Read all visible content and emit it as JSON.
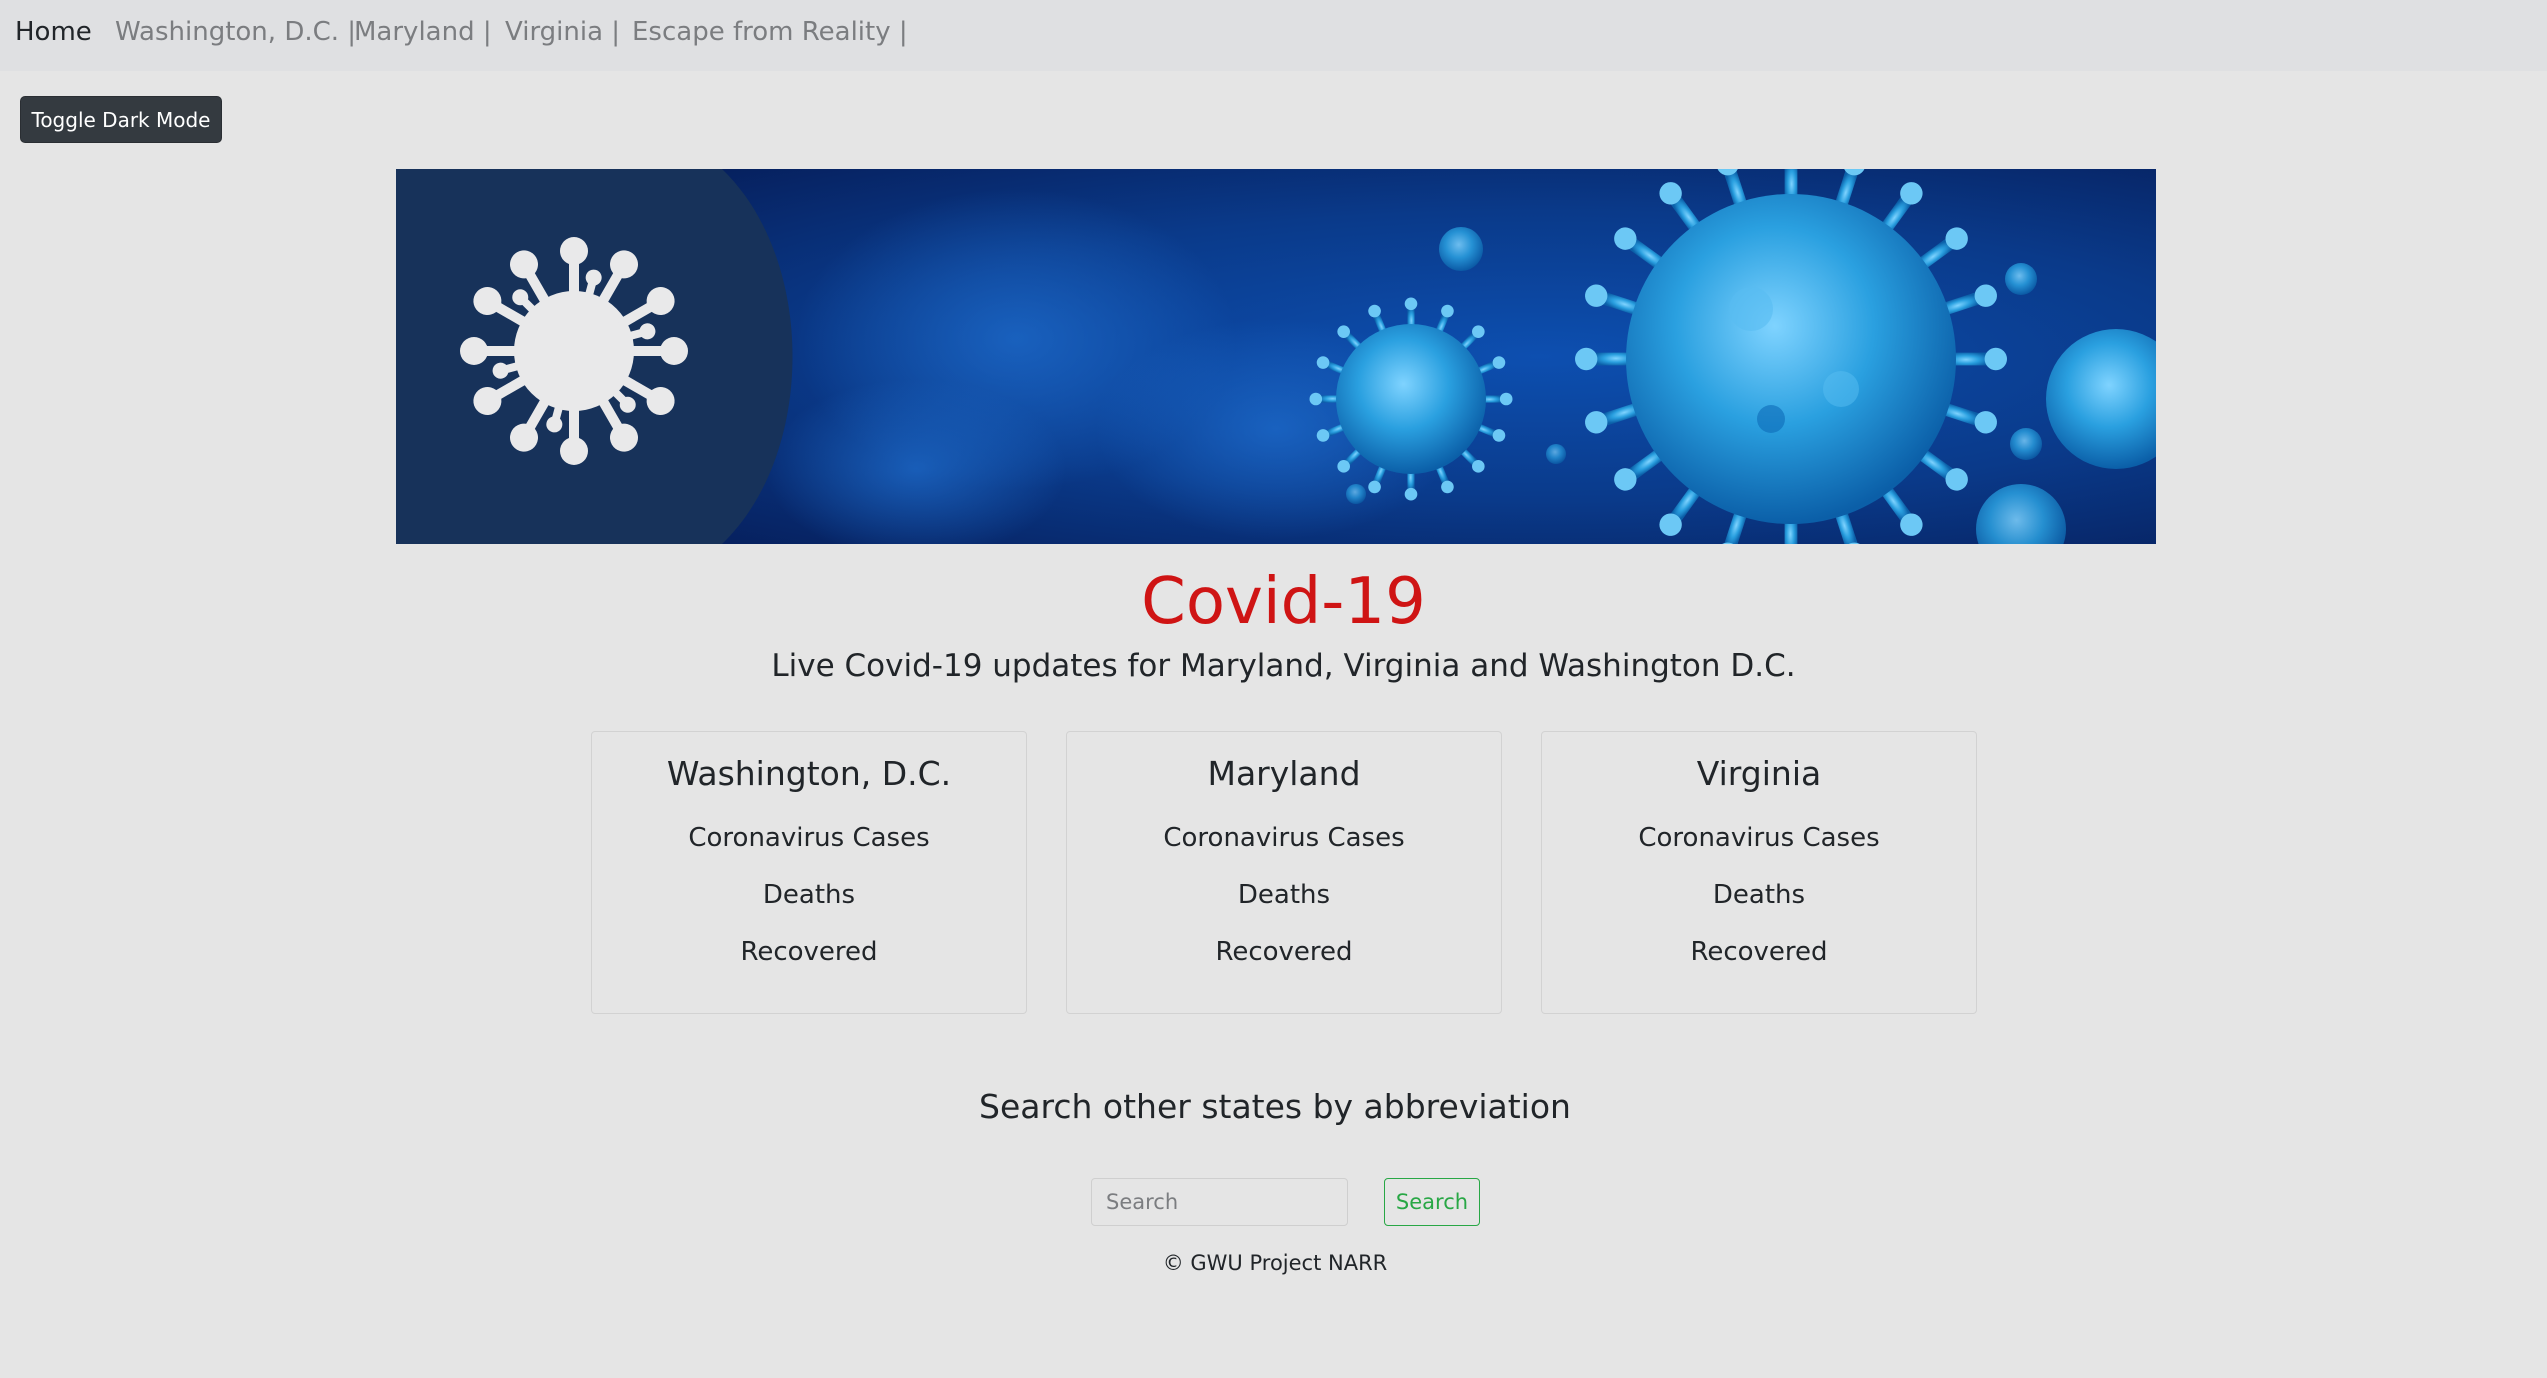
{
  "nav": {
    "items": [
      {
        "label": "Home"
      },
      {
        "label": "Washington, D.C. |"
      },
      {
        "label": "Maryland |"
      },
      {
        "label": "Virginia |"
      },
      {
        "label": "Escape from Reality |"
      }
    ]
  },
  "toggle": {
    "label": "Toggle Dark Mode"
  },
  "banner": {
    "icon": "virus-icon",
    "colors": {
      "panel": "#17325a",
      "background": "#0a3a8a",
      "virus": "#2aa0e0"
    }
  },
  "hero": {
    "title": "Covid-19",
    "subtitle": "Live Covid-19 updates for Maryland, Virginia and Washington D.C."
  },
  "cards": [
    {
      "title": "Washington, D.C.",
      "cases": "Coronavirus Cases",
      "deaths": "Deaths",
      "recovered": "Recovered"
    },
    {
      "title": "Maryland",
      "cases": "Coronavirus Cases",
      "deaths": "Deaths",
      "recovered": "Recovered"
    },
    {
      "title": "Virginia",
      "cases": "Coronavirus Cases",
      "deaths": "Deaths",
      "recovered": "Recovered"
    }
  ],
  "search": {
    "heading": "Search other states by abbreviation",
    "placeholder": "Search",
    "button_label": "Search"
  },
  "footer": {
    "text": "© GWU Project NARR"
  },
  "colors": {
    "title": "#cf1414",
    "success": "#28a745",
    "dark_button": "#343a40",
    "navbar": "#dfe0e2"
  }
}
